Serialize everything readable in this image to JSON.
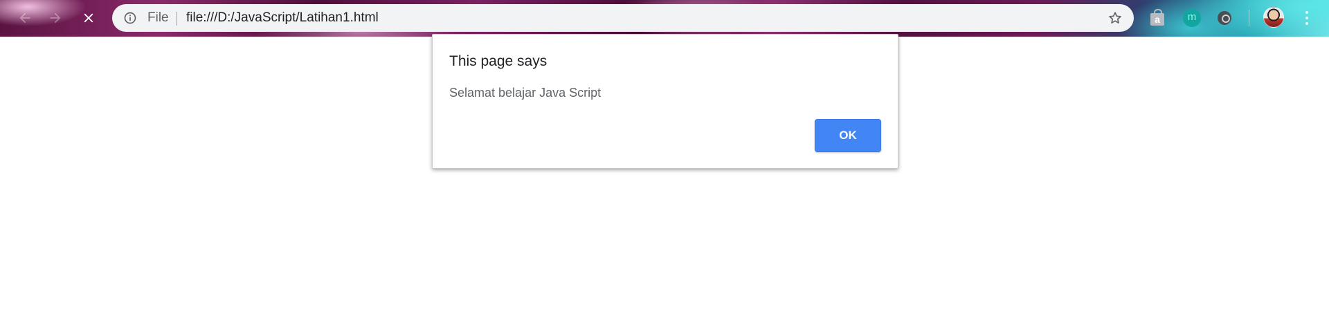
{
  "browser": {
    "omnibox": {
      "scheme_chip": "File",
      "url": "file:///D:/JavaScript/Latihan1.html"
    },
    "extensions": {
      "ext_a_letter": "a",
      "ext_m_letter": "m"
    },
    "icons": {
      "back": "back-arrow-icon",
      "forward": "forward-arrow-icon",
      "stop": "stop-icon",
      "info": "info-icon",
      "bookmark": "star-icon",
      "menu": "more-vert-icon"
    }
  },
  "dialog": {
    "title": "This page says",
    "message": "Selamat belajar Java Script",
    "ok_label": "OK"
  },
  "colors": {
    "accent": "#4285f4",
    "dialog_bg": "#ffffff",
    "omnibox_bg": "#f1f3f4"
  }
}
